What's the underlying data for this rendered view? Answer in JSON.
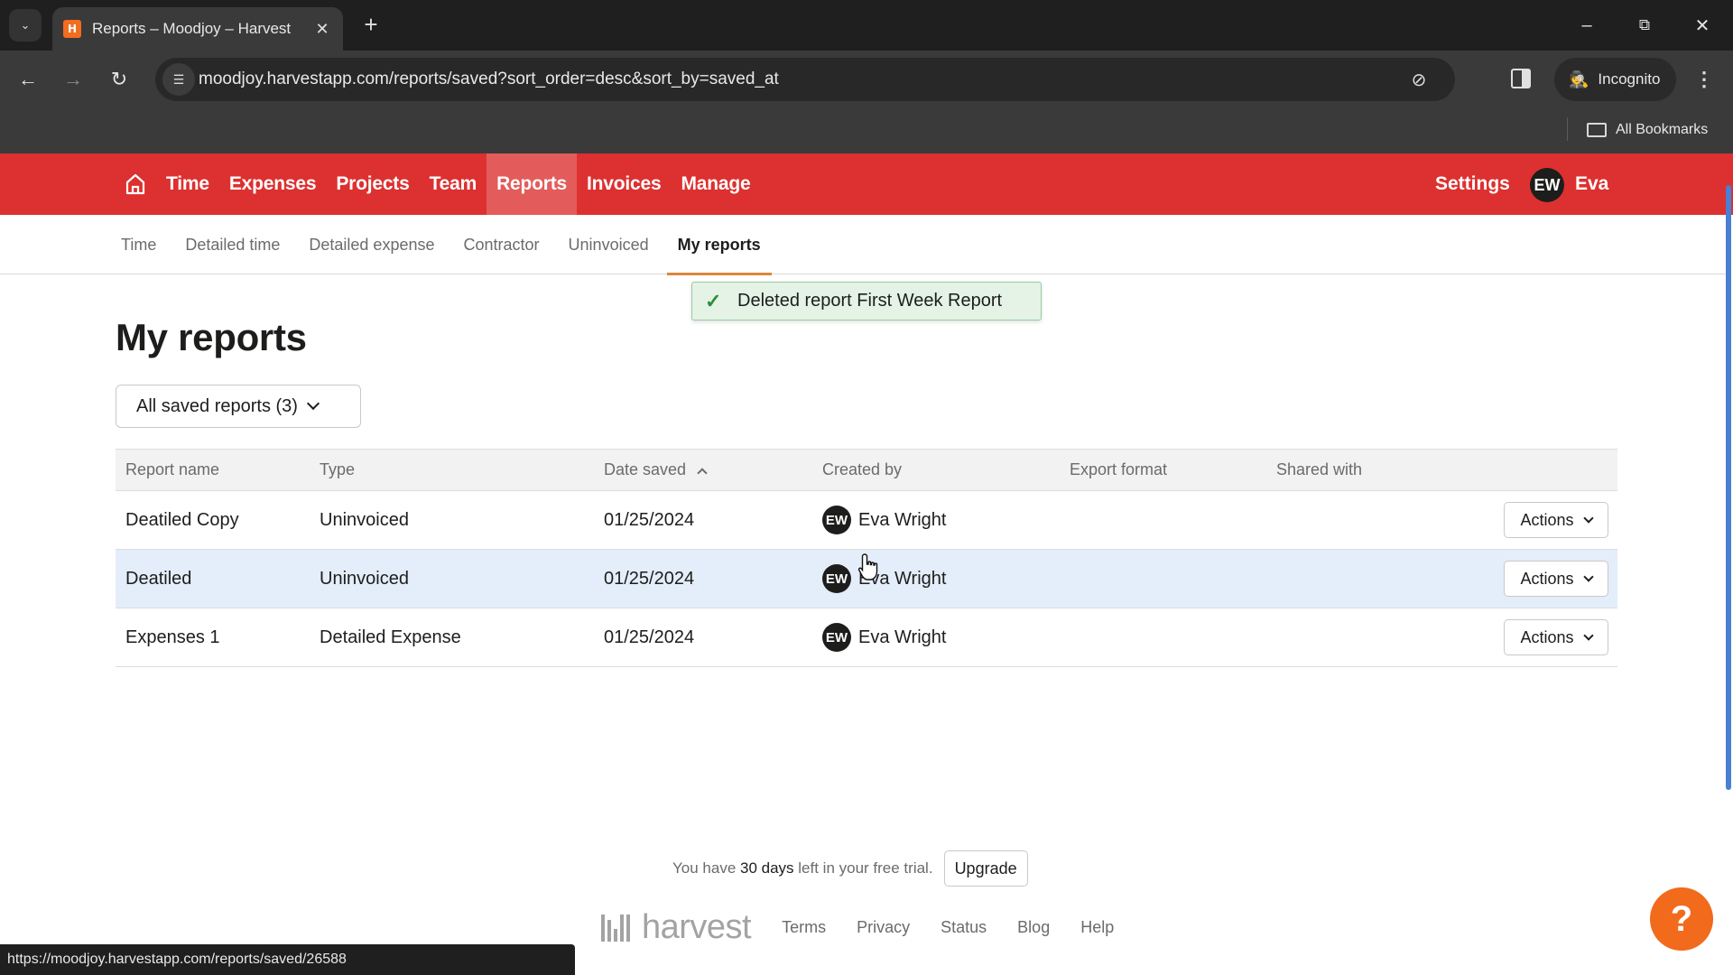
{
  "browser": {
    "tab_title": "Reports – Moodjoy – Harvest",
    "url": "moodjoy.harvestapp.com/reports/saved?sort_order=desc&sort_by=saved_at",
    "incognito_label": "Incognito",
    "all_bookmarks_label": "All Bookmarks",
    "status_url": "https://moodjoy.harvestapp.com/reports/saved/26588"
  },
  "header": {
    "nav": [
      {
        "label": "Time",
        "active": false
      },
      {
        "label": "Expenses",
        "active": false
      },
      {
        "label": "Projects",
        "active": false
      },
      {
        "label": "Team",
        "active": false
      },
      {
        "label": "Reports",
        "active": true
      },
      {
        "label": "Invoices",
        "active": false
      },
      {
        "label": "Manage",
        "active": false
      }
    ],
    "settings_label": "Settings",
    "user_initials": "EW",
    "user_name": "Eva",
    "brand_color": "#dc3130"
  },
  "subnav": {
    "items": [
      {
        "label": "Time",
        "active": false
      },
      {
        "label": "Detailed time",
        "active": false
      },
      {
        "label": "Detailed expense",
        "active": false
      },
      {
        "label": "Contractor",
        "active": false
      },
      {
        "label": "Uninvoiced",
        "active": false
      },
      {
        "label": "My reports",
        "active": true
      }
    ]
  },
  "toast": {
    "icon": "check-icon",
    "message": "Deleted report First Week Report"
  },
  "main": {
    "title": "My reports",
    "filter_label": "All saved reports (3)",
    "table": {
      "columns": [
        "Report name",
        "Type",
        "Date saved",
        "Created by",
        "Export format",
        "Shared with",
        ""
      ],
      "sort_column": "Date saved",
      "rows": [
        {
          "name": "Deatiled Copy",
          "type": "Uninvoiced",
          "date": "01/25/2024",
          "creator_initials": "EW",
          "creator": "Eva Wright",
          "export_format": "",
          "shared_with": "",
          "actions_label": "Actions",
          "highlighted": false
        },
        {
          "name": "Deatiled",
          "type": "Uninvoiced",
          "date": "01/25/2024",
          "creator_initials": "EW",
          "creator": "Eva Wright",
          "export_format": "",
          "shared_with": "",
          "actions_label": "Actions",
          "highlighted": true
        },
        {
          "name": "Expenses 1",
          "type": "Detailed Expense",
          "date": "01/25/2024",
          "creator_initials": "EW",
          "creator": "Eva Wright",
          "export_format": "",
          "shared_with": "",
          "actions_label": "Actions",
          "highlighted": false
        }
      ]
    }
  },
  "footer": {
    "trial_prefix": "You have ",
    "trial_days": "30 days",
    "trial_suffix": " left in your free trial.",
    "upgrade_label": "Upgrade",
    "logo_text": "harvest",
    "links": [
      "Terms",
      "Privacy",
      "Status",
      "Blog",
      "Help"
    ],
    "help_button": "?"
  }
}
